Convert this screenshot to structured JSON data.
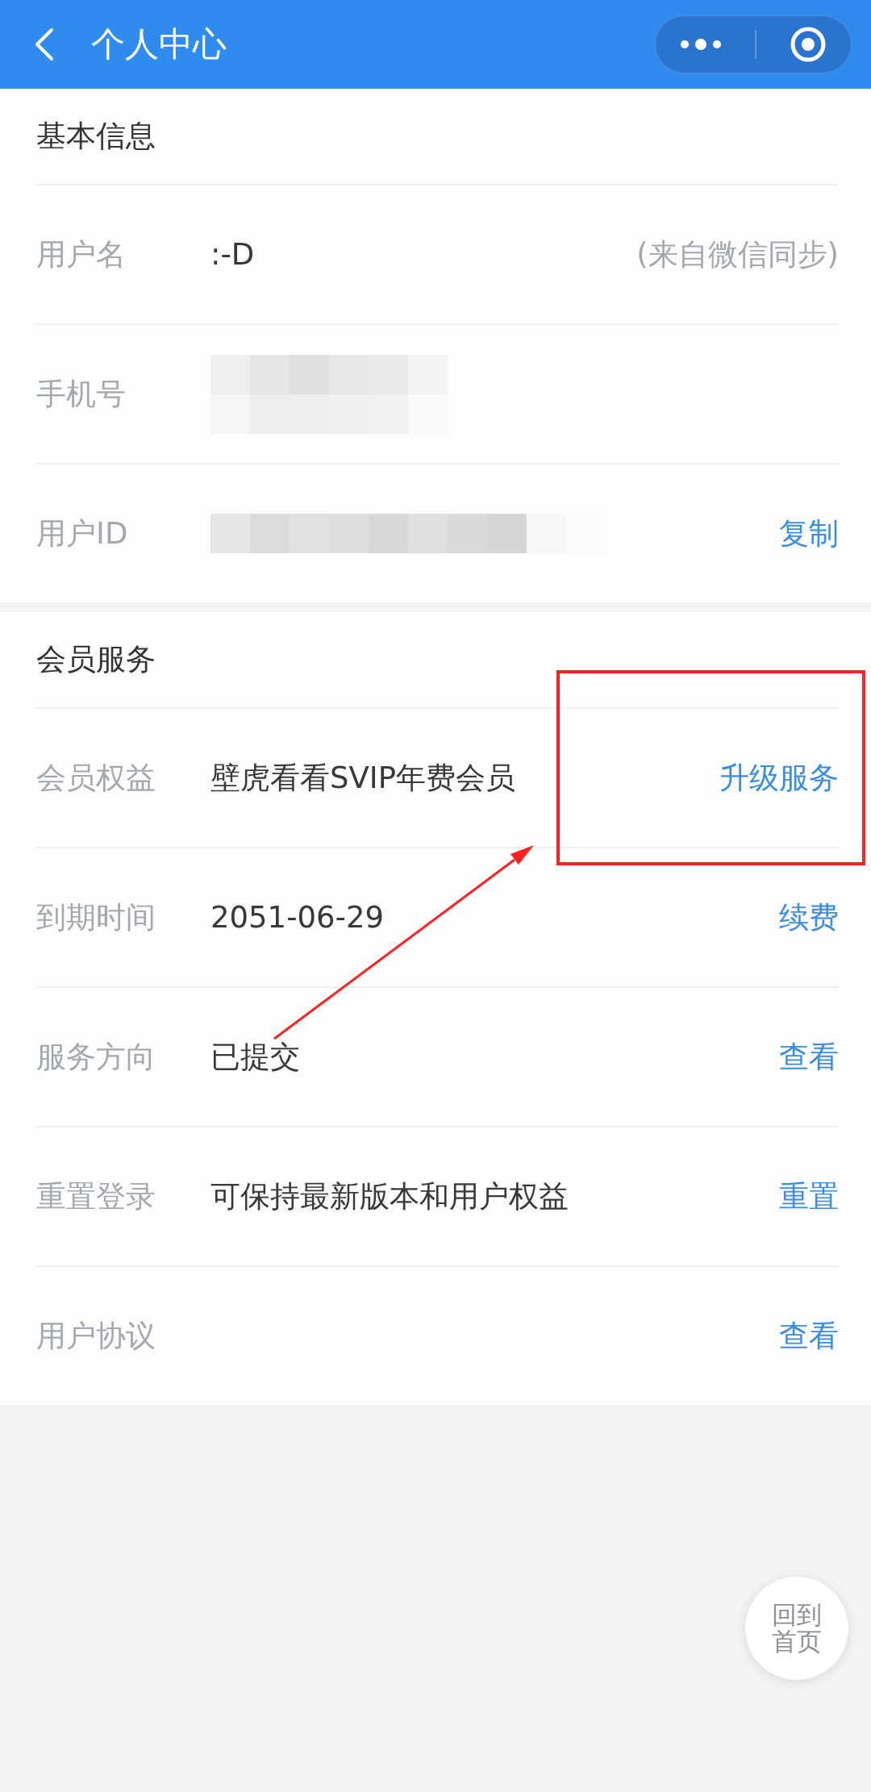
{
  "header": {
    "title": "个人中心"
  },
  "sections": [
    {
      "title": "基本信息",
      "rows": [
        {
          "label": "用户名",
          "value": ":-D",
          "redacted": false,
          "highlighted": false,
          "action": {
            "label": "(来自微信同步)",
            "kind": "note"
          }
        },
        {
          "label": "手机号",
          "redacted": true,
          "highlighted": false
        },
        {
          "label": "用户ID",
          "redacted": true,
          "highlighted": false,
          "action": {
            "label": "复制",
            "kind": "link"
          }
        }
      ]
    },
    {
      "title": "会员服务",
      "rows": [
        {
          "label": "会员权益",
          "value": "壁虎看看SVIP年费会员",
          "redacted": false,
          "highlighted": true,
          "action": {
            "label": "升级服务",
            "kind": "link"
          }
        },
        {
          "label": "到期时间",
          "value": "2051-06-29",
          "redacted": false,
          "highlighted": false,
          "action": {
            "label": "续费",
            "kind": "link"
          }
        },
        {
          "label": "服务方向",
          "value": "已提交",
          "redacted": false,
          "highlighted": false,
          "action": {
            "label": "查看",
            "kind": "link"
          }
        },
        {
          "label": "重置登录",
          "value": "可保持最新版本和用户权益",
          "redacted": false,
          "highlighted": false,
          "action": {
            "label": "重置",
            "kind": "link"
          }
        },
        {
          "label": "用户协议",
          "highlighted": false,
          "action": {
            "label": "查看",
            "kind": "link"
          }
        }
      ]
    }
  ],
  "home_button": {
    "label": "回到首页"
  }
}
